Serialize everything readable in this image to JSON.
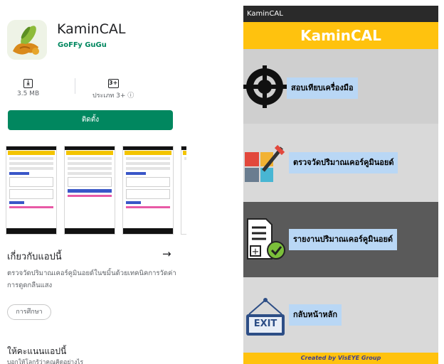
{
  "store": {
    "app_name": "KaminCAL",
    "developer": "GoFFy GuGu",
    "size_icon_glyph": "⤓",
    "size_value": "3.5 MB",
    "rating_icon_glyph": "3+",
    "rating_value": "ประเภท 3+ ⓘ",
    "install_label": "ติดตั้ง",
    "about_title": "เกี่ยวกับแอปนี้",
    "about_arrow": "→",
    "about_description": "ตรวจวัดปริมาณเคอร์คูมินอยด์ในขมิ้นด้วยเทคนิคการวัดค่าการดูดกลืนแสง",
    "category_chip": "การศึกษา",
    "rate_title": "ให้คะแนนแอปนี้",
    "rate_subtitle": "บอกให้โลกรู้ว่าคุณคิดอย่างไร"
  },
  "app": {
    "status_title": "KaminCAL",
    "header_title": "KaminCAL",
    "menu": [
      {
        "label": "สอบเทียบเครื่องมือ",
        "icon": "crosshair-target-icon"
      },
      {
        "label": "ตรวจวัดปริมาณเคอร์คูมินอยด์",
        "icon": "color-dropper-icon"
      },
      {
        "label": "รายงานปริมาณเคอร์คูมินอยด์",
        "icon": "report-check-icon"
      },
      {
        "label": "กลับหน้าหลัก",
        "icon": "exit-sign-icon",
        "icon_text": "EXIT"
      }
    ],
    "footer": "Created by VisEYE Group",
    "colors": {
      "header": "#ffc20e",
      "label_bg": "#b9d7f5",
      "row_gray_light": "#cfcfcf",
      "row_gray_dark": "#5a5a5a",
      "install_green": "#01875f"
    }
  }
}
